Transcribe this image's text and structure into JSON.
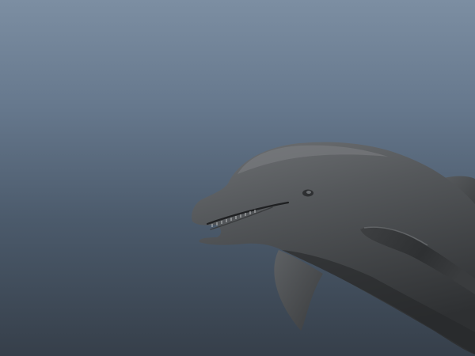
{
  "viewport": {
    "background_top": "#7c8ea2",
    "background_bottom": "#363f4a"
  },
  "model": {
    "subject": "dolphin",
    "shading": "grey-shaded",
    "body_color": "#55585b",
    "highlight_color": "#7a7d80",
    "shadow_color": "#2a2c2e"
  }
}
